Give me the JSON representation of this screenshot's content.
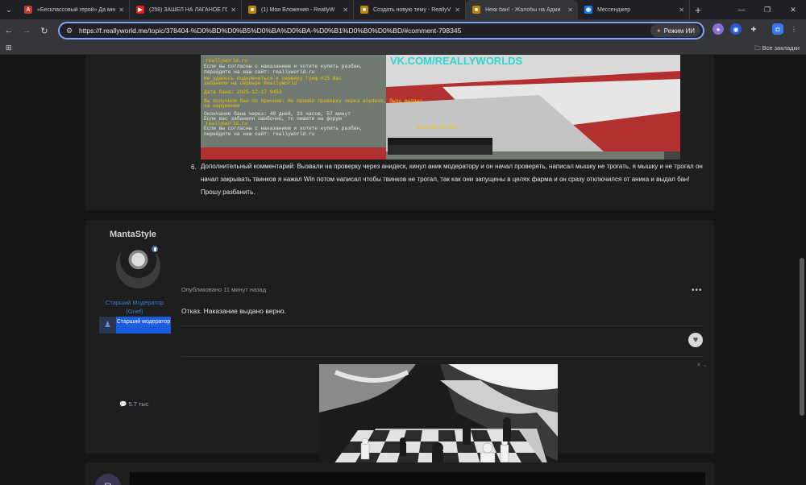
{
  "browser": {
    "tabs": [
      {
        "title": "«Бесклассовый герой» Да мне",
        "favicon": "A",
        "color": "#c0392b"
      },
      {
        "title": "(258) ЗАШЕЛ НА ЛАГАНОЕ ГОЕ",
        "favicon": "▶",
        "color": "#e62117"
      },
      {
        "title": "(1) Мои Вложения - ReallyW",
        "favicon": "■",
        "color": "#b8860b"
      },
      {
        "title": "Создать новую тему - ReallyV",
        "favicon": "■",
        "color": "#b8860b"
      },
      {
        "title": "Некк бан! - Жалобы на Адми",
        "favicon": "■",
        "color": "#b8860b",
        "active": true
      },
      {
        "title": "Мессенджер",
        "favicon": "◉",
        "color": "#1877f2"
      }
    ],
    "url": "https://f.reallyworld.me/topic/378404-%D0%BD%D0%B5%D0%BA%D0%BA-%D0%B1%D0%B0%D0%BD/#comment-798345",
    "ai_mode_label": "Режим ИИ",
    "bookmarks_all": "Все закладки"
  },
  "screenshot_text": {
    "brand": "VK.COM/REALLYWORLDS",
    "lines": [
      "reallyworld.ru",
      "Если вы согласны с наказанием и хотите купить разбан,",
      "перейдите на наш сайт: reallyworld.ru",
      "Не удалось подключиться к серверу Гриф #25 Вас",
      "забанили на сервере ReallyWorld",
      "Дата бана: 2025-12-17 9453",
      "Вы получили бан по причине: Не прошёл проверку через anydesk, было выдано",
      "за нарушение",
      "Окончание бана через: 49 дней, 23 часов, 57 минут",
      "Если вас забанили ошибочно, то пишите на форум",
      "reallyworld.ru",
      "Если вы согласны с наказанием и хотите купить разбан,",
      "перейдите на наш сайт: reallyworld.ru"
    ],
    "hud": "[КОЛ-ВО 10] 100"
  },
  "top_post": {
    "item_number": "6.",
    "comment": "Дополнительный комментарий: Вызвали на проверку через анидеск, кинул аник модератору и он начал проверять, написал мышку не трогать, я мышку и не трогал он начал закрывать твинков я нажал Win потом написал чтобы твинков не трогал, так как они запущены в целях фарма и он сразу отключился от аника и выдал бан! Прошу разбанить."
  },
  "reply": {
    "author": "MantaStyle",
    "rank_line1": "Старший Модератор",
    "rank_line2": "(Grief)",
    "badge_label": "Старший модератор",
    "reputation": "5.7 тыс",
    "posted": "Опубликовано 11 минут назад",
    "more": "•••",
    "body": "Отказ. Наказание выдано верно.",
    "close": "✕ ⌄"
  },
  "next_post": {
    "avatar_letter": "R"
  }
}
